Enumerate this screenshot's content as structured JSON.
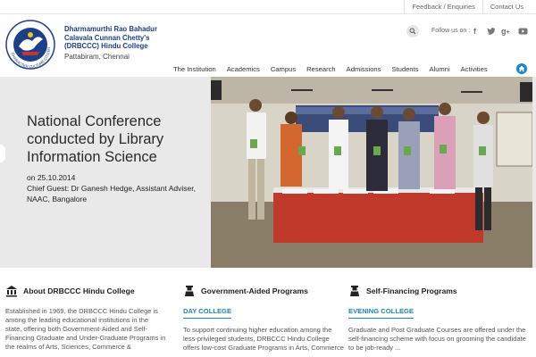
{
  "topbar": {
    "feedback": "Feedback / Enquiries",
    "contact": "Contact Us"
  },
  "brand": {
    "line1": "Dharmamurthi Rao Bahadur",
    "line2": "Calavala Cunnan Chetty's",
    "line3": "(DRBCCC) Hindu College",
    "line4": "Pattabiram, Chennai",
    "logo_text": "CHARACTER • CULTURE • CITIZENSHIP"
  },
  "header": {
    "follow_label": "Follow us on :",
    "social": {
      "facebook": "f",
      "twitter": "twitter-icon",
      "gplus": "g+",
      "youtube": "youtube-icon"
    }
  },
  "nav": {
    "items": [
      "The Institution",
      "Academics",
      "Campus",
      "Research",
      "Admissions",
      "Students",
      "Alumni",
      "Activities"
    ]
  },
  "hero": {
    "title": "National Conference conducted by Library Information Science",
    "date": "on 25.10.2014",
    "guest": "Chief Guest: Dr Ganesh Hedge, Assistant Adviser, NAAC, Bangalore"
  },
  "columns": [
    {
      "title": "About DRBCCC Hindu College",
      "icon": "bank-icon",
      "text": "Established in 1969, the DRBCCC Hindu College is among the leading educational institutions in the state, offering both Government-Aided and Self-Financing Graduate and Under-Graduate Programs in the realms of Arts, Sciences, Commerce &"
    },
    {
      "title": "Government-Aided Programs",
      "icon": "graduate-icon",
      "subtitle": "DAY COLLEGE",
      "text": "To support continuing higher education among the less-privileged students, DRBCCC Hindu College offers low-cost Graduate Programs in Arts, Commerce"
    },
    {
      "title": "Self-Financing Programs",
      "icon": "graduate-icon",
      "subtitle": "EVENING COLLEGE",
      "text": "Graduate and Post Graduate Courses are offered under the self-financing scheme with focus on grooming the candidate to be job-ready ..."
    }
  ],
  "colors": {
    "brand_blue": "#1d3f8a",
    "accent": "#1a84c6"
  }
}
